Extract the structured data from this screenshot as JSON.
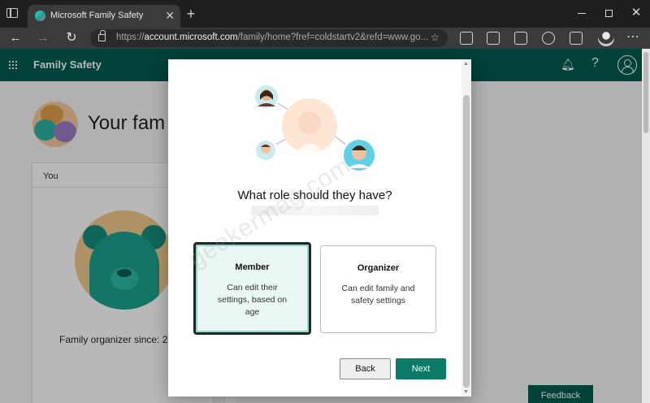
{
  "browser": {
    "tab_title": "Microsoft Family Safety",
    "url_prefix": "https://",
    "url_host": "account.microsoft.com",
    "url_rest": "/family/home?fref=coldstartv2&refd=www.go..."
  },
  "app": {
    "title": "Family Safety"
  },
  "page": {
    "title": "Your fam",
    "card_header": "You",
    "card_caption": "Family organizer since: 2",
    "feedback_label": "Feedback"
  },
  "dialog": {
    "title": "What role should they have?",
    "roles": [
      {
        "name": "Member",
        "description": "Can edit their settings, based on age",
        "selected": true
      },
      {
        "name": "Organizer",
        "description": "Can edit family and safety settings",
        "selected": false
      }
    ],
    "back_label": "Back",
    "next_label": "Next",
    "watermark": "geekermag.com"
  },
  "colors": {
    "header": "#005a4e",
    "accent": "#0b7a67",
    "selected_card_bg": "#eaf7f4"
  }
}
